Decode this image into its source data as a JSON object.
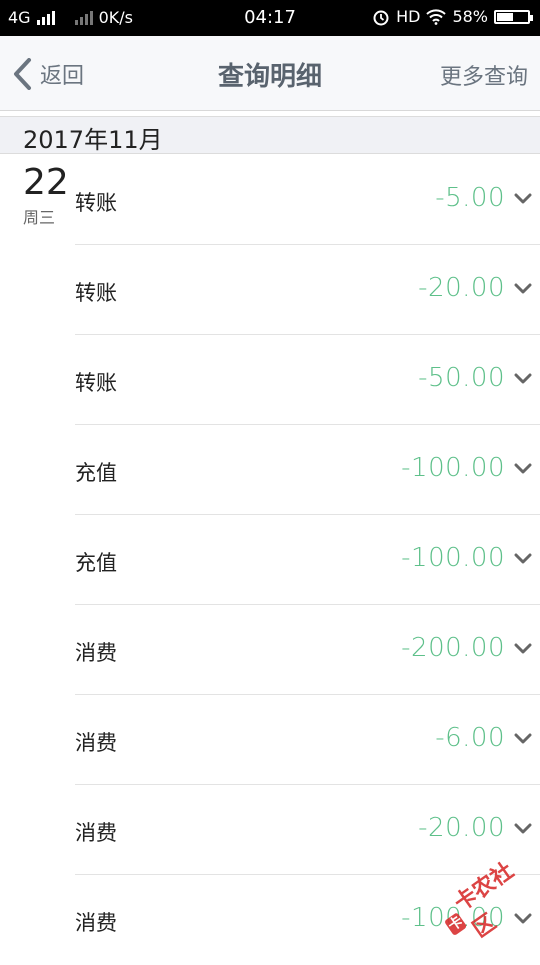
{
  "status": {
    "network": "4G",
    "speed": "0K/s",
    "time": "04:17",
    "hd": "HD",
    "battery": "58%",
    "battery_level": 0.58
  },
  "nav": {
    "back": "返回",
    "title": "查询明细",
    "more": "更多查询"
  },
  "month": "2017年11月",
  "date": {
    "day": "22",
    "weekday": "周三"
  },
  "items": [
    {
      "label": "转账",
      "amount": "-5.00"
    },
    {
      "label": "转账",
      "amount": "-20.00"
    },
    {
      "label": "转账",
      "amount": "-50.00"
    },
    {
      "label": "充值",
      "amount": "-100.00"
    },
    {
      "label": "充值",
      "amount": "-100.00"
    },
    {
      "label": "消费",
      "amount": "-200.00"
    },
    {
      "label": "消费",
      "amount": "-6.00"
    },
    {
      "label": "消费",
      "amount": "-20.00"
    },
    {
      "label": "消费",
      "amount": "-100.00"
    }
  ],
  "watermark": {
    "text": "卡农社区",
    "logo": "卡"
  },
  "colors": {
    "amount": "#5ec08a",
    "nav_text": "#6b7580"
  }
}
